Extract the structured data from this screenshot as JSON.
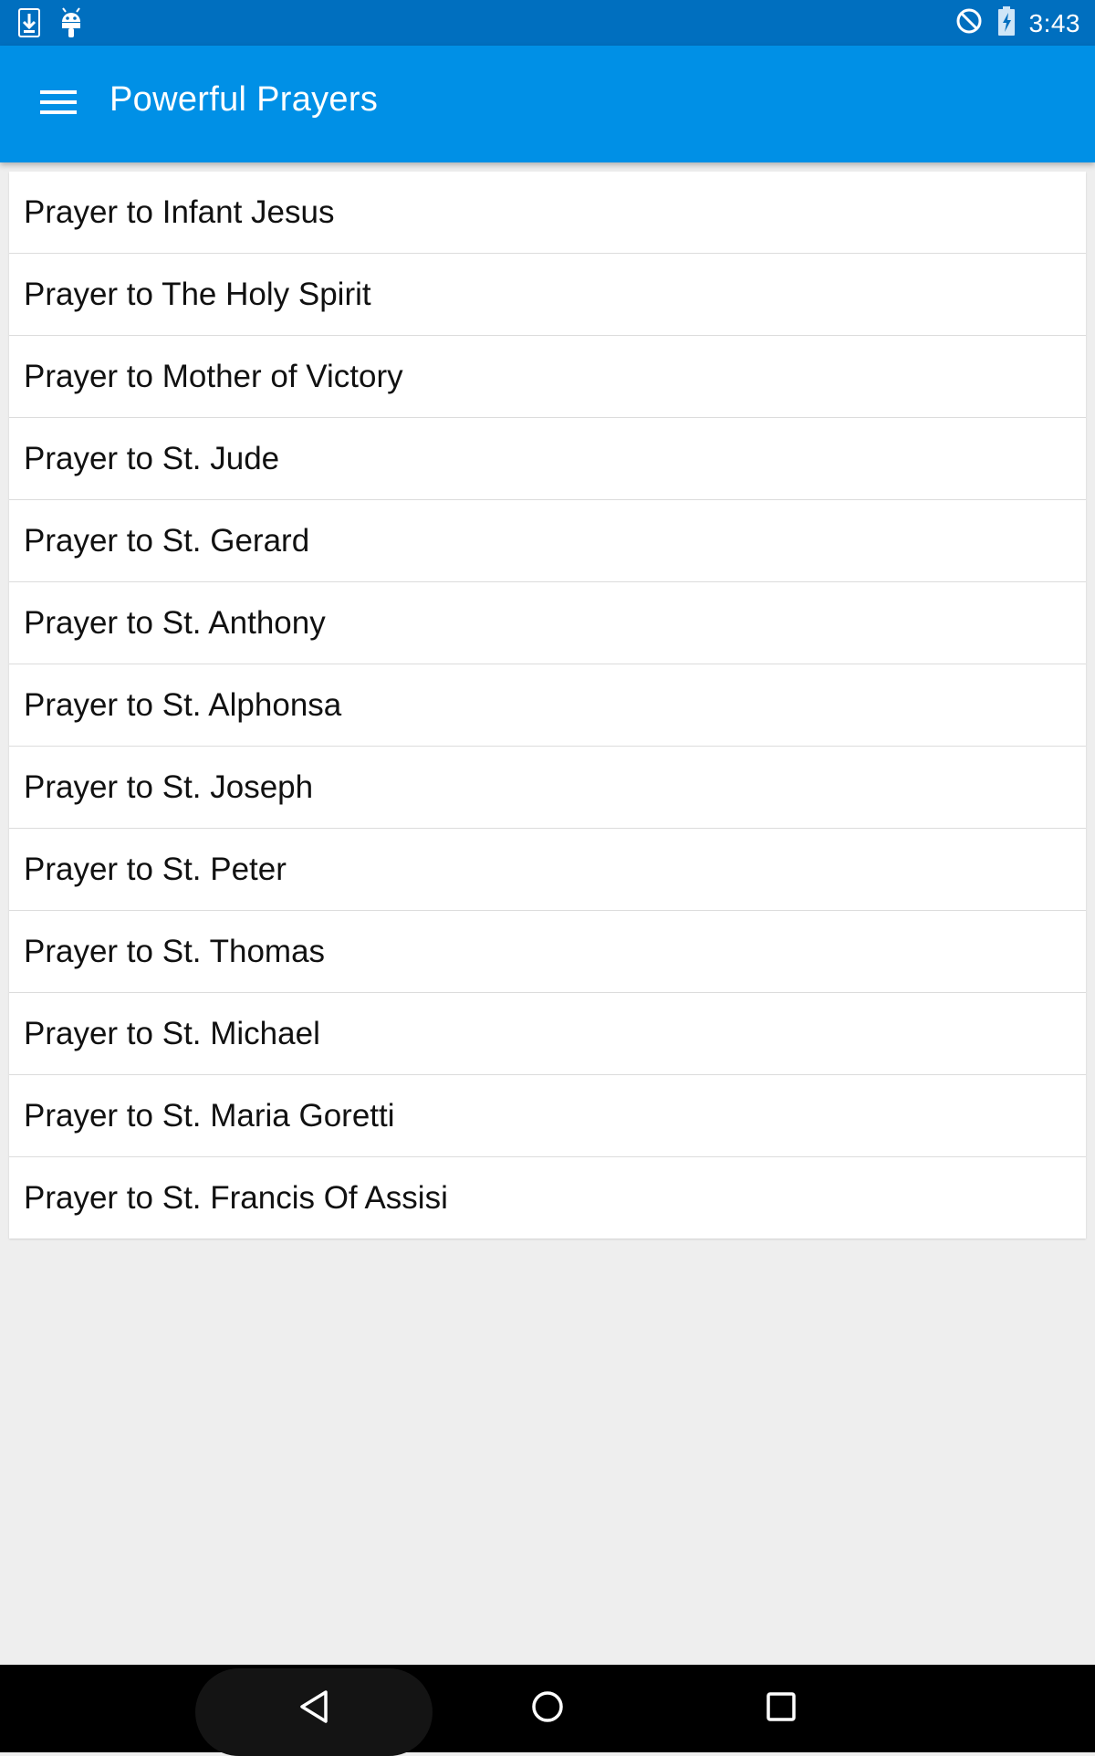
{
  "status_bar": {
    "time": "3:43",
    "icons": [
      "download-icon",
      "android-icon",
      "do-not-disturb-icon",
      "battery-charging-icon"
    ]
  },
  "app_bar": {
    "title": "Powerful Prayers",
    "menu_icon": "hamburger-menu-icon",
    "background": "#0090e6"
  },
  "prayers": [
    {
      "label": "Prayer to Infant Jesus"
    },
    {
      "label": "Prayer to The Holy Spirit"
    },
    {
      "label": "Prayer to Mother of Victory"
    },
    {
      "label": "Prayer to St. Jude"
    },
    {
      "label": "Prayer to St. Gerard"
    },
    {
      "label": "Prayer to St. Anthony"
    },
    {
      "label": "Prayer to St. Alphonsa"
    },
    {
      "label": "Prayer to St. Joseph"
    },
    {
      "label": "Prayer to St. Peter"
    },
    {
      "label": "Prayer to St. Thomas"
    },
    {
      "label": "Prayer to St. Michael"
    },
    {
      "label": "Prayer to St. Maria Goretti"
    },
    {
      "label": "Prayer to St. Francis Of Assisi"
    }
  ],
  "nav_bar": {
    "buttons": [
      "back-icon",
      "home-icon",
      "recents-icon"
    ]
  },
  "colors": {
    "status_bar": "#006fbf",
    "app_bar": "#0090e6",
    "background": "#eeeeee",
    "list_background": "#ffffff",
    "divider": "#dcdcdc"
  }
}
